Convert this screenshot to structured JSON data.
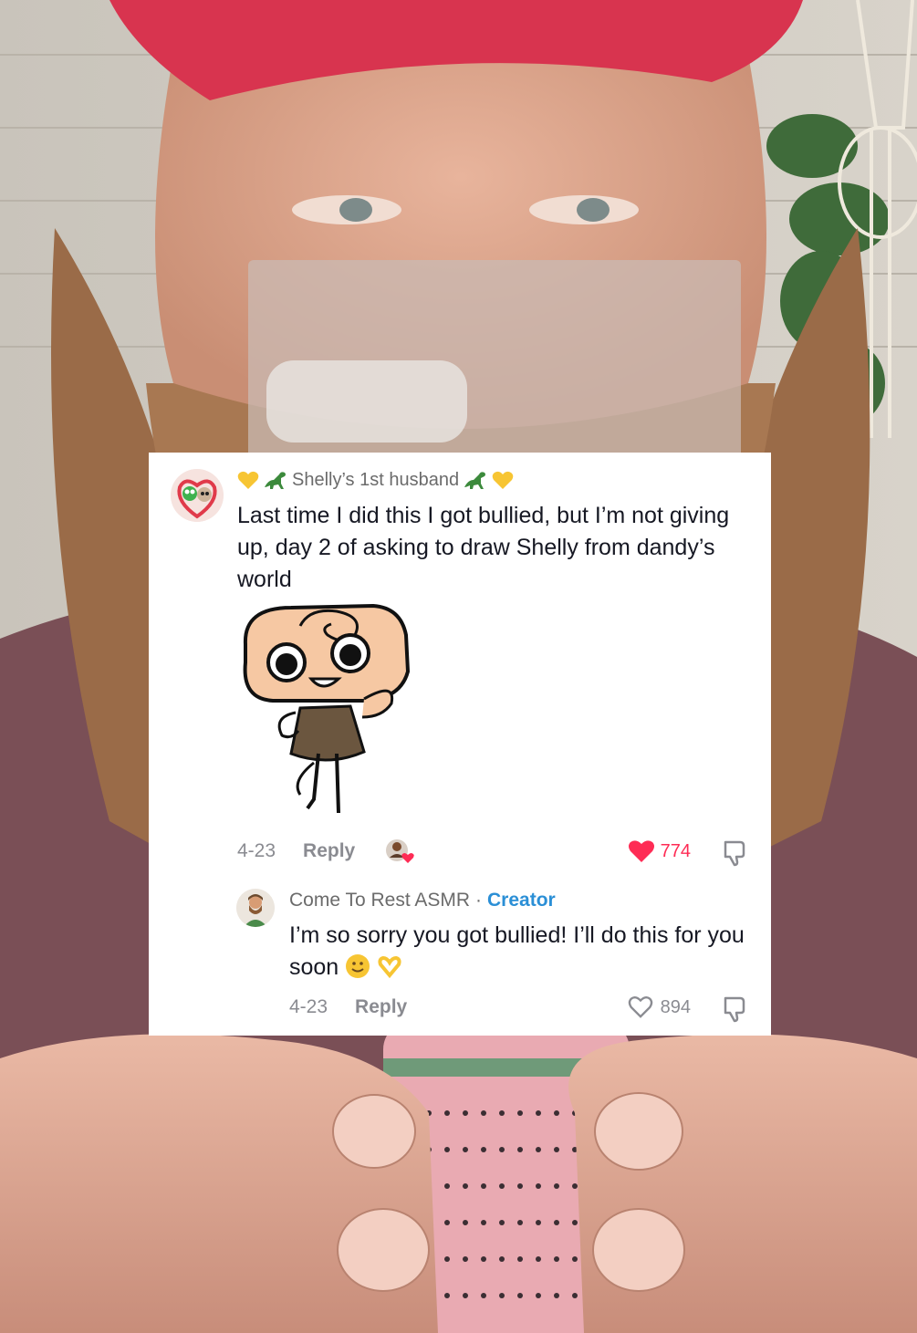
{
  "comment": {
    "username": "Shelly’s 1st husband",
    "text": "Last time I did this I got bullied, but I’m not giving up, day 2 of asking to draw Shelly from dandy’s world",
    "date": "4-23",
    "reply_label": "Reply",
    "likes": "774",
    "liked": true
  },
  "reply": {
    "username": "Come To Rest ASMR",
    "separator": "·",
    "badge": "Creator",
    "text": "I’m so sorry you got bullied! I’ll do this for you soon",
    "date": "4-23",
    "reply_label": "Reply",
    "likes": "894"
  },
  "colors": {
    "like_red": "#fe2c55",
    "creator_blue": "#2b8fd6",
    "card_bg": "#ffffff",
    "hat_red": "#d8344f"
  },
  "icons": {
    "heart": "heart-icon",
    "dislike": "thumbs-down-icon",
    "emoji_heart": "yellow-heart-emoji",
    "emoji_dino": "dinosaur-emoji",
    "emoji_smile": "smile-emoji",
    "emoji_hands": "heart-hands-emoji"
  }
}
